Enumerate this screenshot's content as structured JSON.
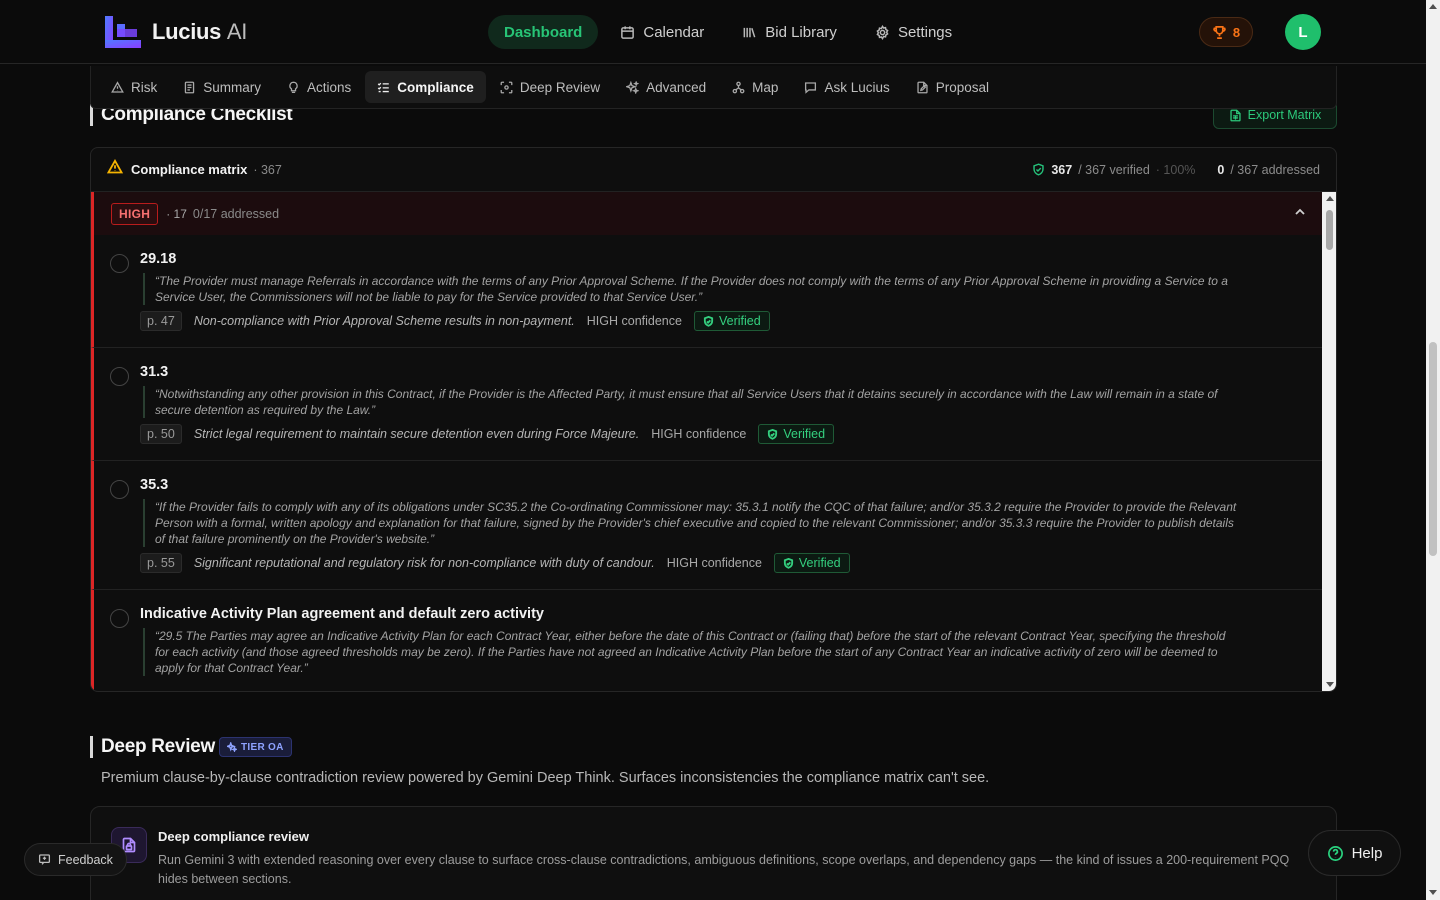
{
  "brand": {
    "name": "Lucius",
    "suffix": "AI"
  },
  "main_nav": [
    {
      "label": "Dashboard",
      "icon": "dashboard",
      "active": true
    },
    {
      "label": "Calendar",
      "icon": "calendar-icon"
    },
    {
      "label": "Bid Library",
      "icon": "library-icon"
    },
    {
      "label": "Settings",
      "icon": "gear-icon"
    }
  ],
  "trophy_count": "8",
  "avatar_initial": "L",
  "tabs": [
    {
      "label": "Risk",
      "icon": "warning-icon"
    },
    {
      "label": "Summary",
      "icon": "document-icon"
    },
    {
      "label": "Actions",
      "icon": "lightbulb-icon"
    },
    {
      "label": "Compliance",
      "icon": "checklist-icon",
      "active": true
    },
    {
      "label": "Deep Review",
      "icon": "scan-icon"
    },
    {
      "label": "Advanced",
      "icon": "sparkles-icon"
    },
    {
      "label": "Map",
      "icon": "network-icon"
    },
    {
      "label": "Ask Lucius",
      "icon": "chat-icon"
    },
    {
      "label": "Proposal",
      "icon": "edit-document-icon"
    }
  ],
  "compliance": {
    "section_title": "Compliance Checklist",
    "export_label": "Export Matrix",
    "matrix_title": "Compliance matrix",
    "matrix_count": "· 367",
    "verified_num": "367",
    "verified_text": "/ 367 verified",
    "verified_pct": "· 100%",
    "addressed_num": "0",
    "addressed_text": "/ 367 addressed",
    "group": {
      "badge": "HIGH",
      "count": "· 17",
      "addressed": "0/17 addressed"
    },
    "items": [
      {
        "ref": "29.18",
        "quote": "“The Provider must manage Referrals in accordance with the terms of any Prior Approval Scheme. If the Provider does not comply with the terms of any Prior Approval Scheme in providing a Service to a Service User, the Commissioners will not be liable to pay for the Service provided to that Service User.”",
        "page": "p. 47",
        "note": "Non-compliance with Prior Approval Scheme results in non-payment.",
        "confidence": "HIGH confidence",
        "status": "Verified"
      },
      {
        "ref": "31.3",
        "quote": "“Notwithstanding any other provision in this Contract, if the Provider is the Affected Party, it must ensure that all Service Users that it detains securely in accordance with the Law will remain in a state of secure detention as required by the Law.”",
        "page": "p. 50",
        "note": "Strict legal requirement to maintain secure detention even during Force Majeure.",
        "confidence": "HIGH confidence",
        "status": "Verified"
      },
      {
        "ref": "35.3",
        "quote": "“If the Provider fails to comply with any of its obligations under SC35.2 the Co-ordinating Commissioner may: 35.3.1 notify the CQC of that failure; and/or 35.3.2 require the Provider to provide the Relevant Person with a formal, written apology and explanation for that failure, signed by the Provider's chief executive and copied to the relevant Commissioner; and/or 35.3.3 require the Provider to publish details of that failure prominently on the Provider's website.”",
        "page": "p. 55",
        "note": "Significant reputational and regulatory risk for non-compliance with duty of candour.",
        "confidence": "HIGH confidence",
        "status": "Verified"
      },
      {
        "ref": "Indicative Activity Plan agreement and default zero activity",
        "quote": "“29.5 The Parties may agree an Indicative Activity Plan for each Contract Year, either before the date of this Contract or (failing that) before the start of the relevant Contract Year, specifying the threshold for each activity (and those agreed thresholds may be zero). If the Parties have not agreed an Indicative Activity Plan before the start of any Contract Year an indicative activity of zero will be deemed to apply for that Contract Year.”",
        "page": "",
        "note": "",
        "confidence": "",
        "status": ""
      }
    ]
  },
  "deep_review": {
    "section_title": "Deep Review",
    "tier": "TIER OA",
    "description": "Premium clause-by-clause contradiction review powered by Gemini Deep Think. Surfaces inconsistencies the compliance matrix can't see.",
    "card_title": "Deep compliance review",
    "card_desc": "Run Gemini 3 with extended reasoning over every clause to surface cross-clause contradictions, ambiguous definitions, scope overlaps, and dependency gaps — the kind of issues a 200-requirement PQQ hides between sections."
  },
  "feedback_label": "Feedback",
  "help_label": "Help"
}
